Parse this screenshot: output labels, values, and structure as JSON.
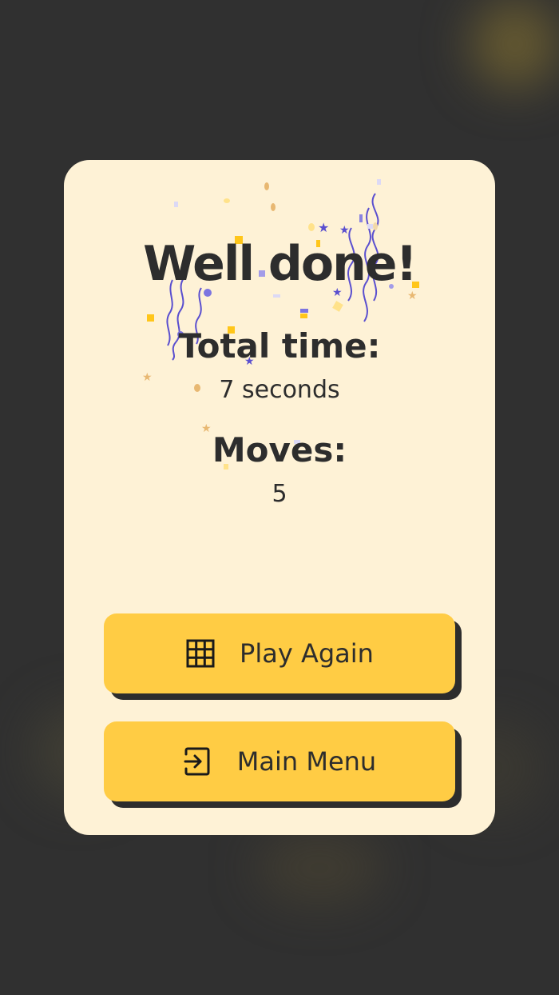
{
  "dialog": {
    "title": "Well done!",
    "total_time_label": "Total time:",
    "total_time_value": "7 seconds",
    "moves_label": "Moves:",
    "moves_value": "5"
  },
  "buttons": {
    "play_again": {
      "label": "Play Again",
      "icon": "grid-icon"
    },
    "main_menu": {
      "label": "Main Menu",
      "icon": "exit-icon"
    }
  },
  "colors": {
    "background": "#303030",
    "card": "#FEF2D6",
    "button": "#FFCC44",
    "text": "#2d2d2d",
    "confetti_purple": "#5A4FCF",
    "confetti_yellow": "#FFC61A",
    "confetti_tan": "#E8B872"
  }
}
